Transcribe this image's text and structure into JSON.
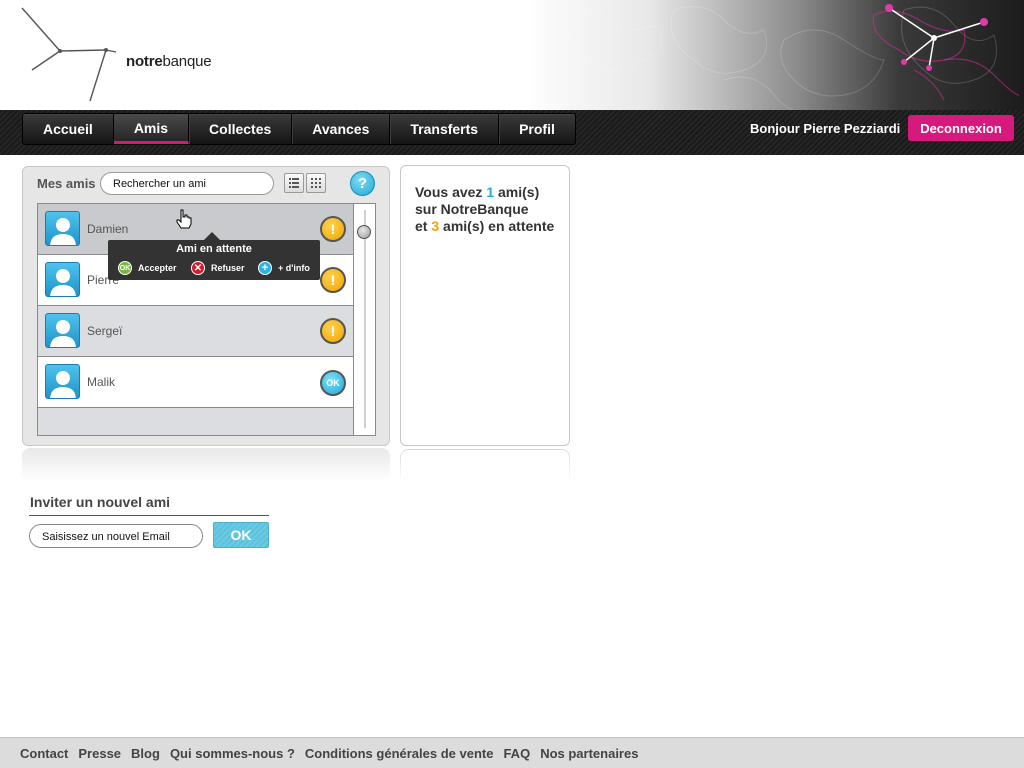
{
  "header": {
    "logo_bold": "notre",
    "logo_light": "banque"
  },
  "nav": {
    "items": [
      "Accueil",
      "Amis",
      "Collectes",
      "Avances",
      "Transferts",
      "Profil"
    ],
    "active": "Amis"
  },
  "user": {
    "greeting": "Bonjour Pierre Pezziardi",
    "logout_label": "Deconnexion"
  },
  "friends": {
    "title": "Mes amis",
    "search_value": "Rechercher un ami",
    "help_label": "?",
    "list": [
      {
        "name": "Damien",
        "status": "pending",
        "status_label": "!"
      },
      {
        "name": "Pierre",
        "status": "pending",
        "status_label": "!"
      },
      {
        "name": "Sergeï",
        "status": "pending",
        "status_label": "!"
      },
      {
        "name": "Malik",
        "status": "accepted",
        "status_label": "OK"
      }
    ],
    "tooltip": {
      "title": "Ami en attente",
      "accept_icon": "OK",
      "accept": "Accepter",
      "refuse": "Refuser",
      "info": "+ d'info"
    }
  },
  "summary": {
    "line1_pre": "Vous avez ",
    "friends_count": "1",
    "line1_post": " ami(s)",
    "line2": "sur NotreBanque",
    "line3_pre": "et ",
    "pending_count": "3",
    "line3_post": " ami(s) en attente"
  },
  "invite": {
    "title": "Inviter un nouvel ami",
    "input_value": "Saisissez un nouvel Email",
    "button": "OK"
  },
  "footer": {
    "links": [
      "Contact",
      "Presse",
      "Blog",
      "Qui sommes-nous ?",
      "Conditions générales de vente",
      "FAQ",
      "Nos partenaires"
    ]
  },
  "colors": {
    "accent_pink": "#d6197c",
    "accent_blue": "#2aa9dc",
    "warning_orange": "#f0a500"
  }
}
